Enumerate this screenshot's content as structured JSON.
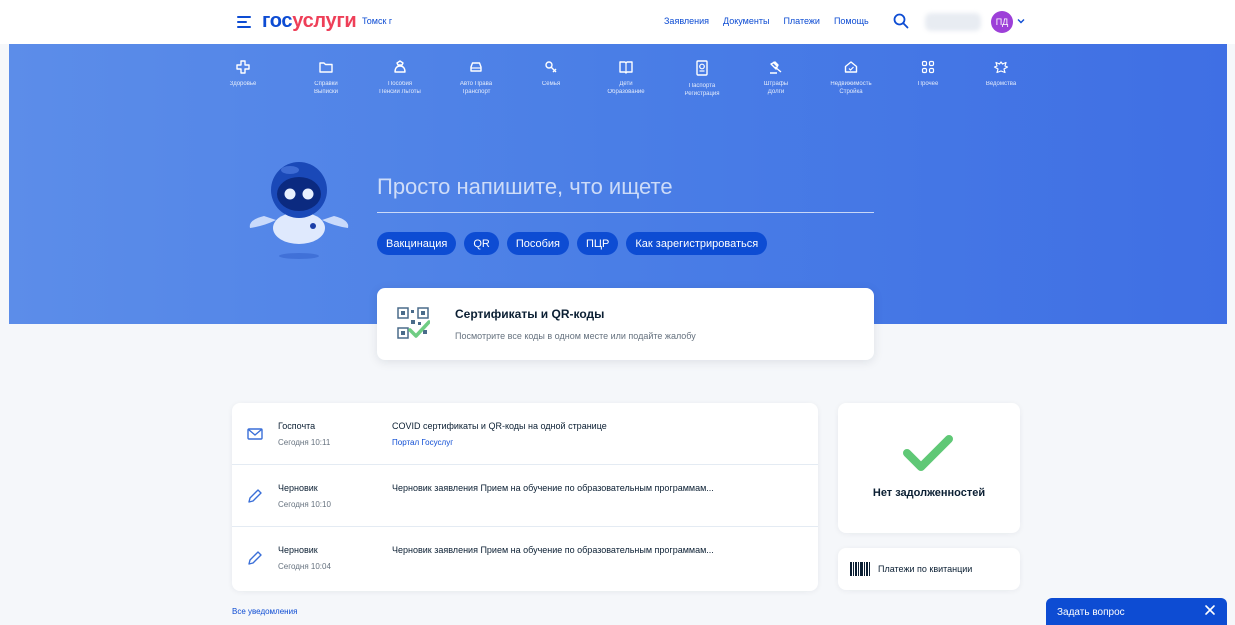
{
  "header": {
    "logo_part1": "гос",
    "logo_part2": "услуги",
    "city": "Томск г",
    "nav": [
      "Заявления",
      "Документы",
      "Платежи",
      "Помощь"
    ],
    "avatar_initials": "ПД"
  },
  "categories": [
    {
      "icon": "plus-cross-icon",
      "l1": "Здоровье",
      "l2": ""
    },
    {
      "icon": "folder-icon",
      "l1": "Справки",
      "l2": "Выписки"
    },
    {
      "icon": "bag-icon",
      "l1": "Пособия",
      "l2": "Пенсии Льготы"
    },
    {
      "icon": "car-icon",
      "l1": "Авто Права",
      "l2": "Транспорт"
    },
    {
      "icon": "pacifier-icon",
      "l1": "Семья",
      "l2": ""
    },
    {
      "icon": "book-icon",
      "l1": "Дети",
      "l2": "Образование"
    },
    {
      "icon": "passport-icon",
      "l1": "Паспорта",
      "l2": "Регистрация"
    },
    {
      "icon": "gavel-icon",
      "l1": "Штрафы",
      "l2": "Долги"
    },
    {
      "icon": "house-icon",
      "l1": "Недвижимость",
      "l2": "Стройка"
    },
    {
      "icon": "grid-icon",
      "l1": "Прочее",
      "l2": ""
    },
    {
      "icon": "eagle-icon",
      "l1": "Ведомства",
      "l2": ""
    }
  ],
  "search": {
    "placeholder": "Просто напишите, что ищете",
    "chips": [
      "Вакцинация",
      "QR",
      "Пособия",
      "ПЦР",
      "Как зарегистрироваться"
    ]
  },
  "promo": {
    "title": "Сертификаты и QR-коды",
    "subtitle": "Посмотрите все коды в одном месте или подайте жалобу"
  },
  "notifications": [
    {
      "icon": "envelope-icon",
      "type": "Госпочта",
      "time": "Сегодня 10:11",
      "text": "COVID сертификаты и QR-коды на одной странице",
      "sub": "Портал Госуслуг"
    },
    {
      "icon": "pencil-icon",
      "type": "Черновик",
      "time": "Сегодня 10:10",
      "text": "Черновик заявления Прием на обучение по образовательным программам...",
      "sub": ""
    },
    {
      "icon": "pencil-icon",
      "type": "Черновик",
      "time": "Сегодня 10:04",
      "text": "Черновик заявления Прием на обучение по образовательным программам...",
      "sub": ""
    }
  ],
  "all_notifications": "Все уведомления",
  "debt": {
    "text": "Нет задолженностей"
  },
  "pay": {
    "text": "Платежи по квитанции"
  },
  "ask": {
    "label": "Задать вопрос"
  },
  "colors": {
    "accent": "#0d4cd3",
    "brand_red": "#ee3f58",
    "check_green": "#5fc876",
    "avatar": "#9d3fd8"
  }
}
